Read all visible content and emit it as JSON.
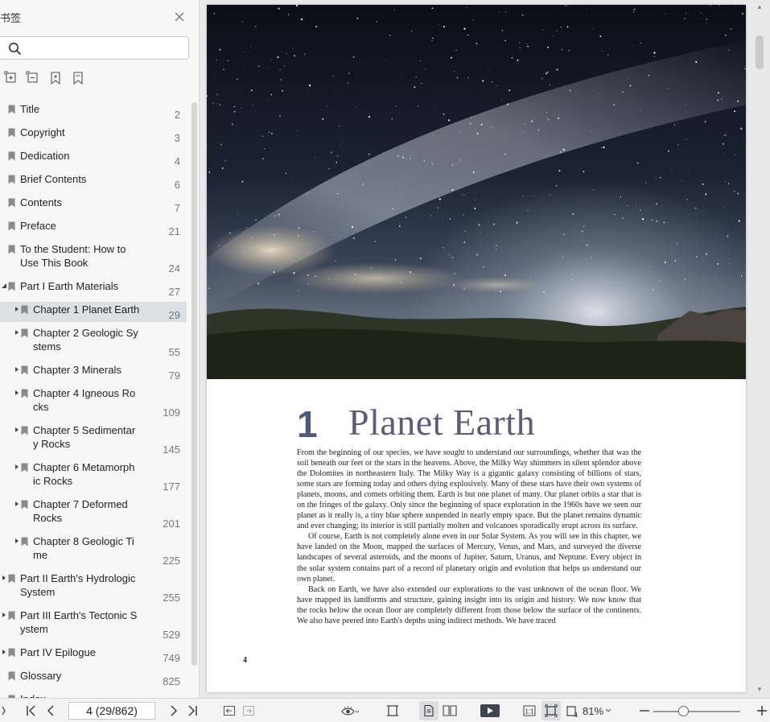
{
  "sidebar": {
    "title": "书签",
    "search": {
      "placeholder": "",
      "value": ""
    },
    "tools": [
      "expand-all-icon",
      "collapse-all-icon",
      "add-bookmark-icon",
      "bookmark-outline-icon"
    ],
    "items": [
      {
        "label1": "Title",
        "label2": "",
        "page": "2",
        "level": 0,
        "expander": "none"
      },
      {
        "label1": "Copyright",
        "label2": "",
        "page": "3",
        "level": 0,
        "expander": "none"
      },
      {
        "label1": "Dedication",
        "label2": "",
        "page": "4",
        "level": 0,
        "expander": "none"
      },
      {
        "label1": "Brief Contents",
        "label2": "",
        "page": "6",
        "level": 0,
        "expander": "none"
      },
      {
        "label1": "Contents",
        "label2": "",
        "page": "7",
        "level": 0,
        "expander": "none"
      },
      {
        "label1": "Preface",
        "label2": "",
        "page": "21",
        "level": 0,
        "expander": "none"
      },
      {
        "label1": "To the Student: How to",
        "label2": "Use This Book",
        "page": "24",
        "level": 0,
        "expander": "none"
      },
      {
        "label1": "Part I Earth Materials",
        "label2": "",
        "page": "27",
        "level": 0,
        "expander": "expanded"
      },
      {
        "label1": "Chapter 1 Planet Earth",
        "label2": "",
        "page": "29",
        "level": 1,
        "expander": "collapsed",
        "selected": true
      },
      {
        "label1": "Chapter 2 Geologic Sy",
        "label2": "stems",
        "page": "55",
        "level": 1,
        "expander": "collapsed"
      },
      {
        "label1": "Chapter 3 Minerals",
        "label2": "",
        "page": "79",
        "level": 1,
        "expander": "collapsed"
      },
      {
        "label1": "Chapter 4 Igneous Ro",
        "label2": "cks",
        "page": "109",
        "level": 1,
        "expander": "collapsed"
      },
      {
        "label1": "Chapter 5 Sedimentar",
        "label2": "y Rocks",
        "page": "145",
        "level": 1,
        "expander": "collapsed"
      },
      {
        "label1": "Chapter 6 Metamorph",
        "label2": "ic Rocks",
        "page": "177",
        "level": 1,
        "expander": "collapsed"
      },
      {
        "label1": "Chapter 7 Deformed",
        "label2": "Rocks",
        "page": "201",
        "level": 1,
        "expander": "collapsed"
      },
      {
        "label1": "Chapter 8 Geologic Ti",
        "label2": "me",
        "page": "225",
        "level": 1,
        "expander": "collapsed"
      },
      {
        "label1": "Part II Earth's Hydrologic",
        "label2": "System",
        "page": "255",
        "level": 0,
        "expander": "collapsed"
      },
      {
        "label1": "Part III Earth's Tectonic S",
        "label2": "ystem",
        "page": "529",
        "level": 0,
        "expander": "collapsed"
      },
      {
        "label1": "Part IV Epilogue",
        "label2": "",
        "page": "749",
        "level": 0,
        "expander": "collapsed"
      },
      {
        "label1": "Glossary",
        "label2": "",
        "page": "825",
        "level": 0,
        "expander": "none"
      },
      {
        "label1": "Index",
        "label2": "",
        "page": "",
        "level": 0,
        "expander": "none"
      }
    ]
  },
  "document": {
    "chapter_number": "1",
    "chapter_title": "Planet Earth",
    "paragraphs": [
      "From the beginning of our species, we have sought to understand our surroundings, whether that was the soil beneath our feet or the stars in the heavens. Above, the Milky Way shimmers in silent splendor above the Dolomites in northeastern Italy. The Milky Way is a gigantic galaxy consisting of billions of stars, some stars are forming today and others dying explosively. Many of these stars have their own systems of planets, moons, and comets orbiting them. Earth is but one planet of many. Our planet orbits a star that is on the fringes of the galaxy. Only since the beginning of space exploration in the 1960s have we seen our planet as it really is, a tiny blue sphere suspended in nearly empty space. But the planet remains dynamic and ever changing; its interior is still partially molten and volcanoes sporadically erupt across its surface.",
      "Of course, Earth is not completely alone even in our Solar System. As you will see in this chapter, we have landed on the Moon, mapped the surfaces of Mercury, Venus, and Mars, and surveyed the diverse landscapes of several asteroids, and the moons of Jupiter, Saturn, Uranus, and Neptune. Every object in the solar system contains part of a record of planetary origin and evolution that helps us understand our own planet.",
      "Back on Earth, we have also extended our explorations to the vast unknown of the ocean floor. We have mapped its landforms and structure, gaining insight into its origin and history. We now know that the rocks below the ocean floor are completely different from those below the surface of the continents. We also have peered into Earth's depths using indirect methods. We have traced"
    ],
    "folio": "4",
    "hero_image": "milky-way-over-dolomites"
  },
  "toolbar": {
    "page_field": "4 (29/862)",
    "zoom": "81%",
    "zoom_slider_fraction": 0.34
  }
}
